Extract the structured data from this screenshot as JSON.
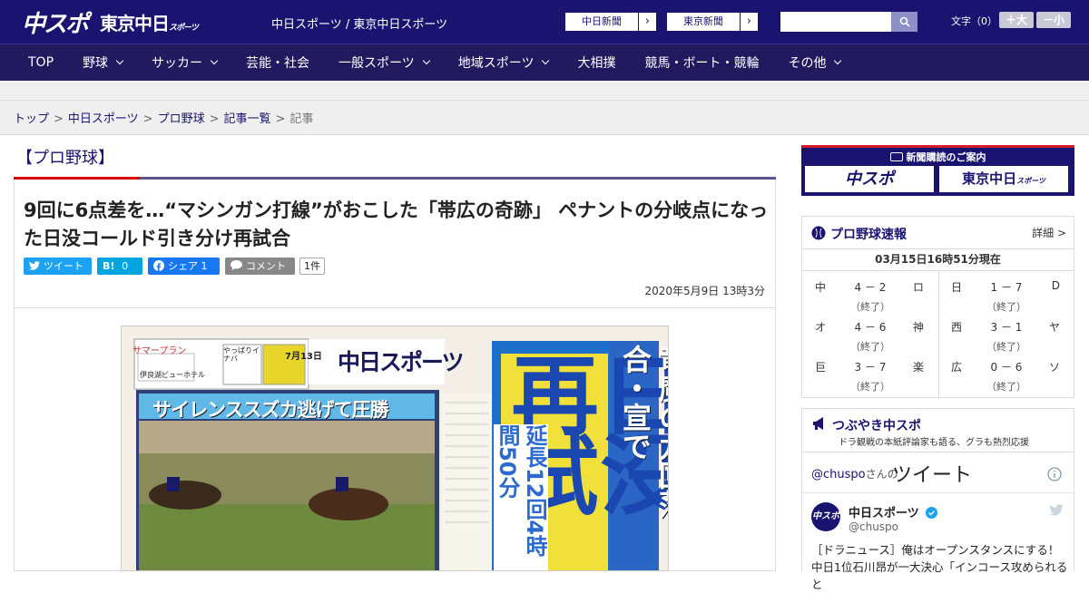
{
  "header": {
    "logo_primary": "中スポ",
    "logo_secondary": "東京中日",
    "logo_secondary_small": "スポーツ",
    "site_name": "中日スポーツ / 東京中日スポーツ",
    "link_chunichi": "中日新聞",
    "link_tokyo": "東京新聞",
    "link_arrow": "›",
    "search_placeholder": "",
    "font_label": "文字（0）",
    "font_bigger": "＋大",
    "font_smaller": "－小"
  },
  "nav": {
    "items": [
      {
        "label": "TOP",
        "dropdown": false
      },
      {
        "label": "野球",
        "dropdown": true
      },
      {
        "label": "サッカー",
        "dropdown": true
      },
      {
        "label": "芸能・社会",
        "dropdown": false
      },
      {
        "label": "一般スポーツ",
        "dropdown": true
      },
      {
        "label": "地域スポーツ",
        "dropdown": true
      },
      {
        "label": "大相撲",
        "dropdown": false
      },
      {
        "label": "競馬・ボート・競輪",
        "dropdown": false
      },
      {
        "label": "その他",
        "dropdown": true
      }
    ]
  },
  "breadcrumb": {
    "items": [
      "トップ",
      "中日スポーツ",
      "プロ野球",
      "記事一覧"
    ],
    "current": "記事",
    "separator": ">"
  },
  "article": {
    "category": "【プロ野球】",
    "headline": "9回に6点差を…“マシンガン打線”がおこした「帯広の奇跡」 ペナントの分岐点になった日没コールド引き分け再試合",
    "share_twitter": "ツイート",
    "share_hatena": "B!",
    "share_hatena_count": "0",
    "share_facebook": "シェア",
    "share_facebook_count": "1",
    "comment_label": "コメント",
    "comment_count": "1件",
    "date": "2020年5月9日 13時3分"
  },
  "photo": {
    "masthead": "中日スポーツ",
    "date_text": "7月13日",
    "racing_headline": "サイレンススズカ逃げて圧勝",
    "side_headline": "竜魔の九回落合・宣で",
    "big_headline": "日没再試",
    "sub_headline": "延長12回4時間50分",
    "ad1": "サマープラン",
    "ad2": "やっぱりイナバ",
    "ad3": "伊良湖ビューホテル"
  },
  "sidebar": {
    "subscribe_title": "新聞購読のご案内",
    "subscribe_chunichi": "中スポ",
    "subscribe_tokyo": "東京中日",
    "subscribe_tokyo_small": "スポーツ",
    "score_title": "プロ野球速報",
    "score_detail": "詳細 >",
    "score_time": "03月15日16時51分現在",
    "games": [
      {
        "home": "中",
        "score": "4 － 2",
        "away": "ロ",
        "status": "（終了）"
      },
      {
        "home": "日",
        "score": "1 － 7",
        "away": "D",
        "status": "（終了）"
      },
      {
        "home": "オ",
        "score": "4 － 6",
        "away": "神",
        "status": "（終了）"
      },
      {
        "home": "西",
        "score": "3 － 1",
        "away": "ヤ",
        "status": "（終了）"
      },
      {
        "home": "巨",
        "score": "3 － 7",
        "away": "楽",
        "status": "（終了）"
      },
      {
        "home": "広",
        "score": "0 － 6",
        "away": "ソ",
        "status": "（終了）"
      }
    ],
    "twitter_title": "つぶやき中スポ",
    "twitter_sub": "ドラ観戦の本紙評論家も語る、グラも熱烈応援",
    "twitter_handle": "@chuspo",
    "twitter_handle_suffix": "さんの",
    "twitter_tweets_label": "ツイート",
    "tweet_name": "中日スポーツ",
    "tweet_user": "@chuspo",
    "tweet_avatar": "中スポ",
    "tweet_text": "［ドラニュース］俺はオープンスタンスにする！中日1位石川昂が一大決心「インコース攻められると"
  },
  "colors": {
    "header_bg": "#1a1470",
    "nav_bg": "#221a5e",
    "accent_red": "#d41c2a",
    "twitter": "#1da1f2",
    "hatena": "#00a4de",
    "facebook": "#1877f2",
    "comment": "#888888"
  }
}
